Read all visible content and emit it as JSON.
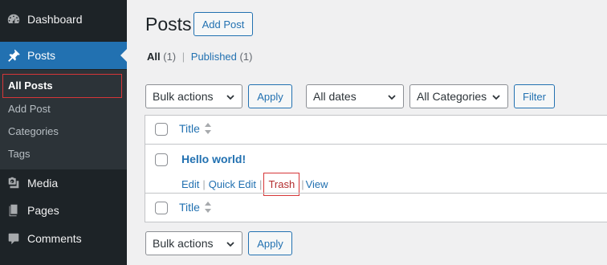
{
  "sidebar": {
    "items": [
      {
        "label": "Dashboard",
        "icon": "dashboard-icon"
      },
      {
        "label": "Posts",
        "icon": "pushpin-icon"
      },
      {
        "label": "Media",
        "icon": "media-icon"
      },
      {
        "label": "Pages",
        "icon": "pages-icon"
      },
      {
        "label": "Comments",
        "icon": "comment-icon"
      }
    ],
    "submenu": [
      {
        "label": "All Posts"
      },
      {
        "label": "Add Post"
      },
      {
        "label": "Categories"
      },
      {
        "label": "Tags"
      }
    ]
  },
  "header": {
    "title": "Posts",
    "add_button": "Add Post"
  },
  "filters": {
    "all_label": "All",
    "all_count": "(1)",
    "separator": "|",
    "published_label": "Published",
    "published_count": "(1)"
  },
  "toolbar": {
    "bulk_actions": "Bulk actions",
    "apply": "Apply",
    "dates": "All dates",
    "categories": "All Categories",
    "filter": "Filter"
  },
  "table": {
    "column_title": "Title",
    "rows": [
      {
        "title": "Hello world!",
        "actions": {
          "edit": "Edit",
          "quick_edit": "Quick Edit",
          "trash": "Trash",
          "view": "View"
        }
      }
    ],
    "footer_title": "Title"
  },
  "bottom_toolbar": {
    "bulk_actions": "Bulk actions",
    "apply": "Apply"
  },
  "colors": {
    "accent": "#2271b1",
    "sidebar_bg": "#1d2327",
    "highlight": "#d63638"
  }
}
